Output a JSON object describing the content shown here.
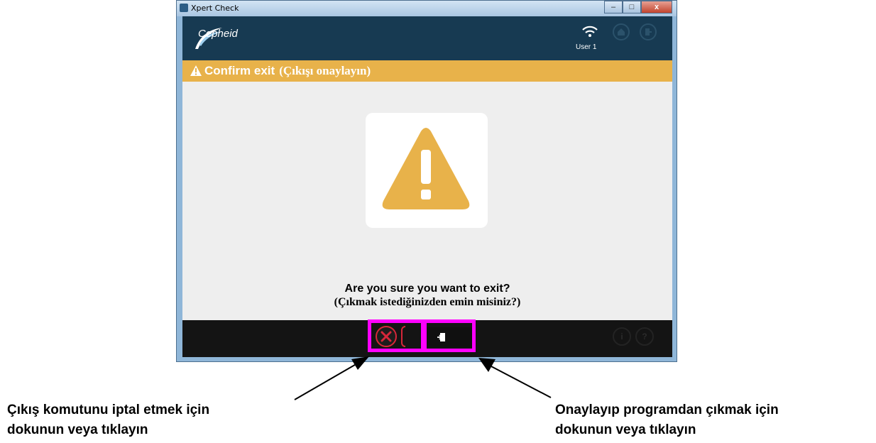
{
  "window": {
    "title": "Xpert Check",
    "controls": {
      "minimize": "–",
      "maximize": "□",
      "close": "x"
    }
  },
  "header": {
    "brand": "Cepheid",
    "user": "User 1"
  },
  "warning_bar": {
    "title_en": "Confirm exit",
    "title_tr": "(Çıkışı onaylayın)"
  },
  "dialog": {
    "question_en": "Are you sure you want to exit?",
    "question_tr": "(Çıkmak istediğinizden emin misiniz?)"
  },
  "footer": {
    "info": "i",
    "help": "?"
  },
  "callouts": {
    "left_line1": "Çıkış komutunu iptal etmek için",
    "left_line2": "dokunun veya tıklayın",
    "right_line1": "Onaylayıp programdan çıkmak için",
    "right_line2": "dokunun veya tıklayın"
  },
  "colors": {
    "highlight": "#ff00ff",
    "warning": "#e8b24a",
    "header_bg": "#173a52",
    "cancel_red": "#d7273a"
  }
}
